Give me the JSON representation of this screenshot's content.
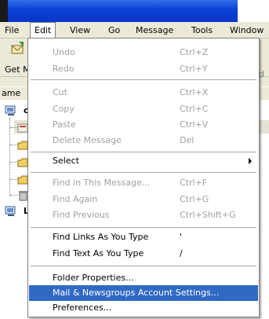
{
  "menubar": {
    "items": [
      {
        "label": "File"
      },
      {
        "label": "Edit"
      },
      {
        "label": "View"
      },
      {
        "label": "Go"
      },
      {
        "label": "Message"
      },
      {
        "label": "Tools"
      },
      {
        "label": "Window"
      }
    ]
  },
  "toolbar": {
    "getm_label": "Get M",
    "right_label": "d"
  },
  "leftpane": {
    "column_header": "ame",
    "account1_label": "cl",
    "account2_label": "L"
  },
  "edit_menu": {
    "items": [
      {
        "label": "Undo",
        "shortcut": "Ctrl+Z",
        "disabled": true
      },
      {
        "label": "Redo",
        "shortcut": "Ctrl+Y",
        "disabled": true
      },
      {
        "label": "Cut",
        "shortcut": "Ctrl+X",
        "disabled": true
      },
      {
        "label": "Copy",
        "shortcut": "Ctrl+C",
        "disabled": true
      },
      {
        "label": "Paste",
        "shortcut": "Ctrl+V",
        "disabled": true
      },
      {
        "label": "Delete Message",
        "shortcut": "Del",
        "disabled": true
      },
      {
        "label": "Select",
        "shortcut": "",
        "disabled": false
      },
      {
        "label": "Find in This Message...",
        "shortcut": "Ctrl+F",
        "disabled": true
      },
      {
        "label": "Find Again",
        "shortcut": "Ctrl+G",
        "disabled": true
      },
      {
        "label": "Find Previous",
        "shortcut": "Ctrl+Shift+G",
        "disabled": true
      },
      {
        "label": "Find Links As You Type",
        "shortcut": "'",
        "disabled": false
      },
      {
        "label": "Find Text As You Type",
        "shortcut": "/",
        "disabled": false
      },
      {
        "label": "Folder Properties...",
        "shortcut": "",
        "disabled": false
      },
      {
        "label": "Mail & Newsgroups Account Settings...",
        "shortcut": "",
        "disabled": false,
        "highlighted": true
      },
      {
        "label": "Preferences...",
        "shortcut": "",
        "disabled": false
      }
    ]
  },
  "colors": {
    "titlebar": "#0a3fd6",
    "menu_bg": "#ece9d8",
    "highlight": "#316ac5",
    "disabled_text": "#a0a0a0"
  }
}
